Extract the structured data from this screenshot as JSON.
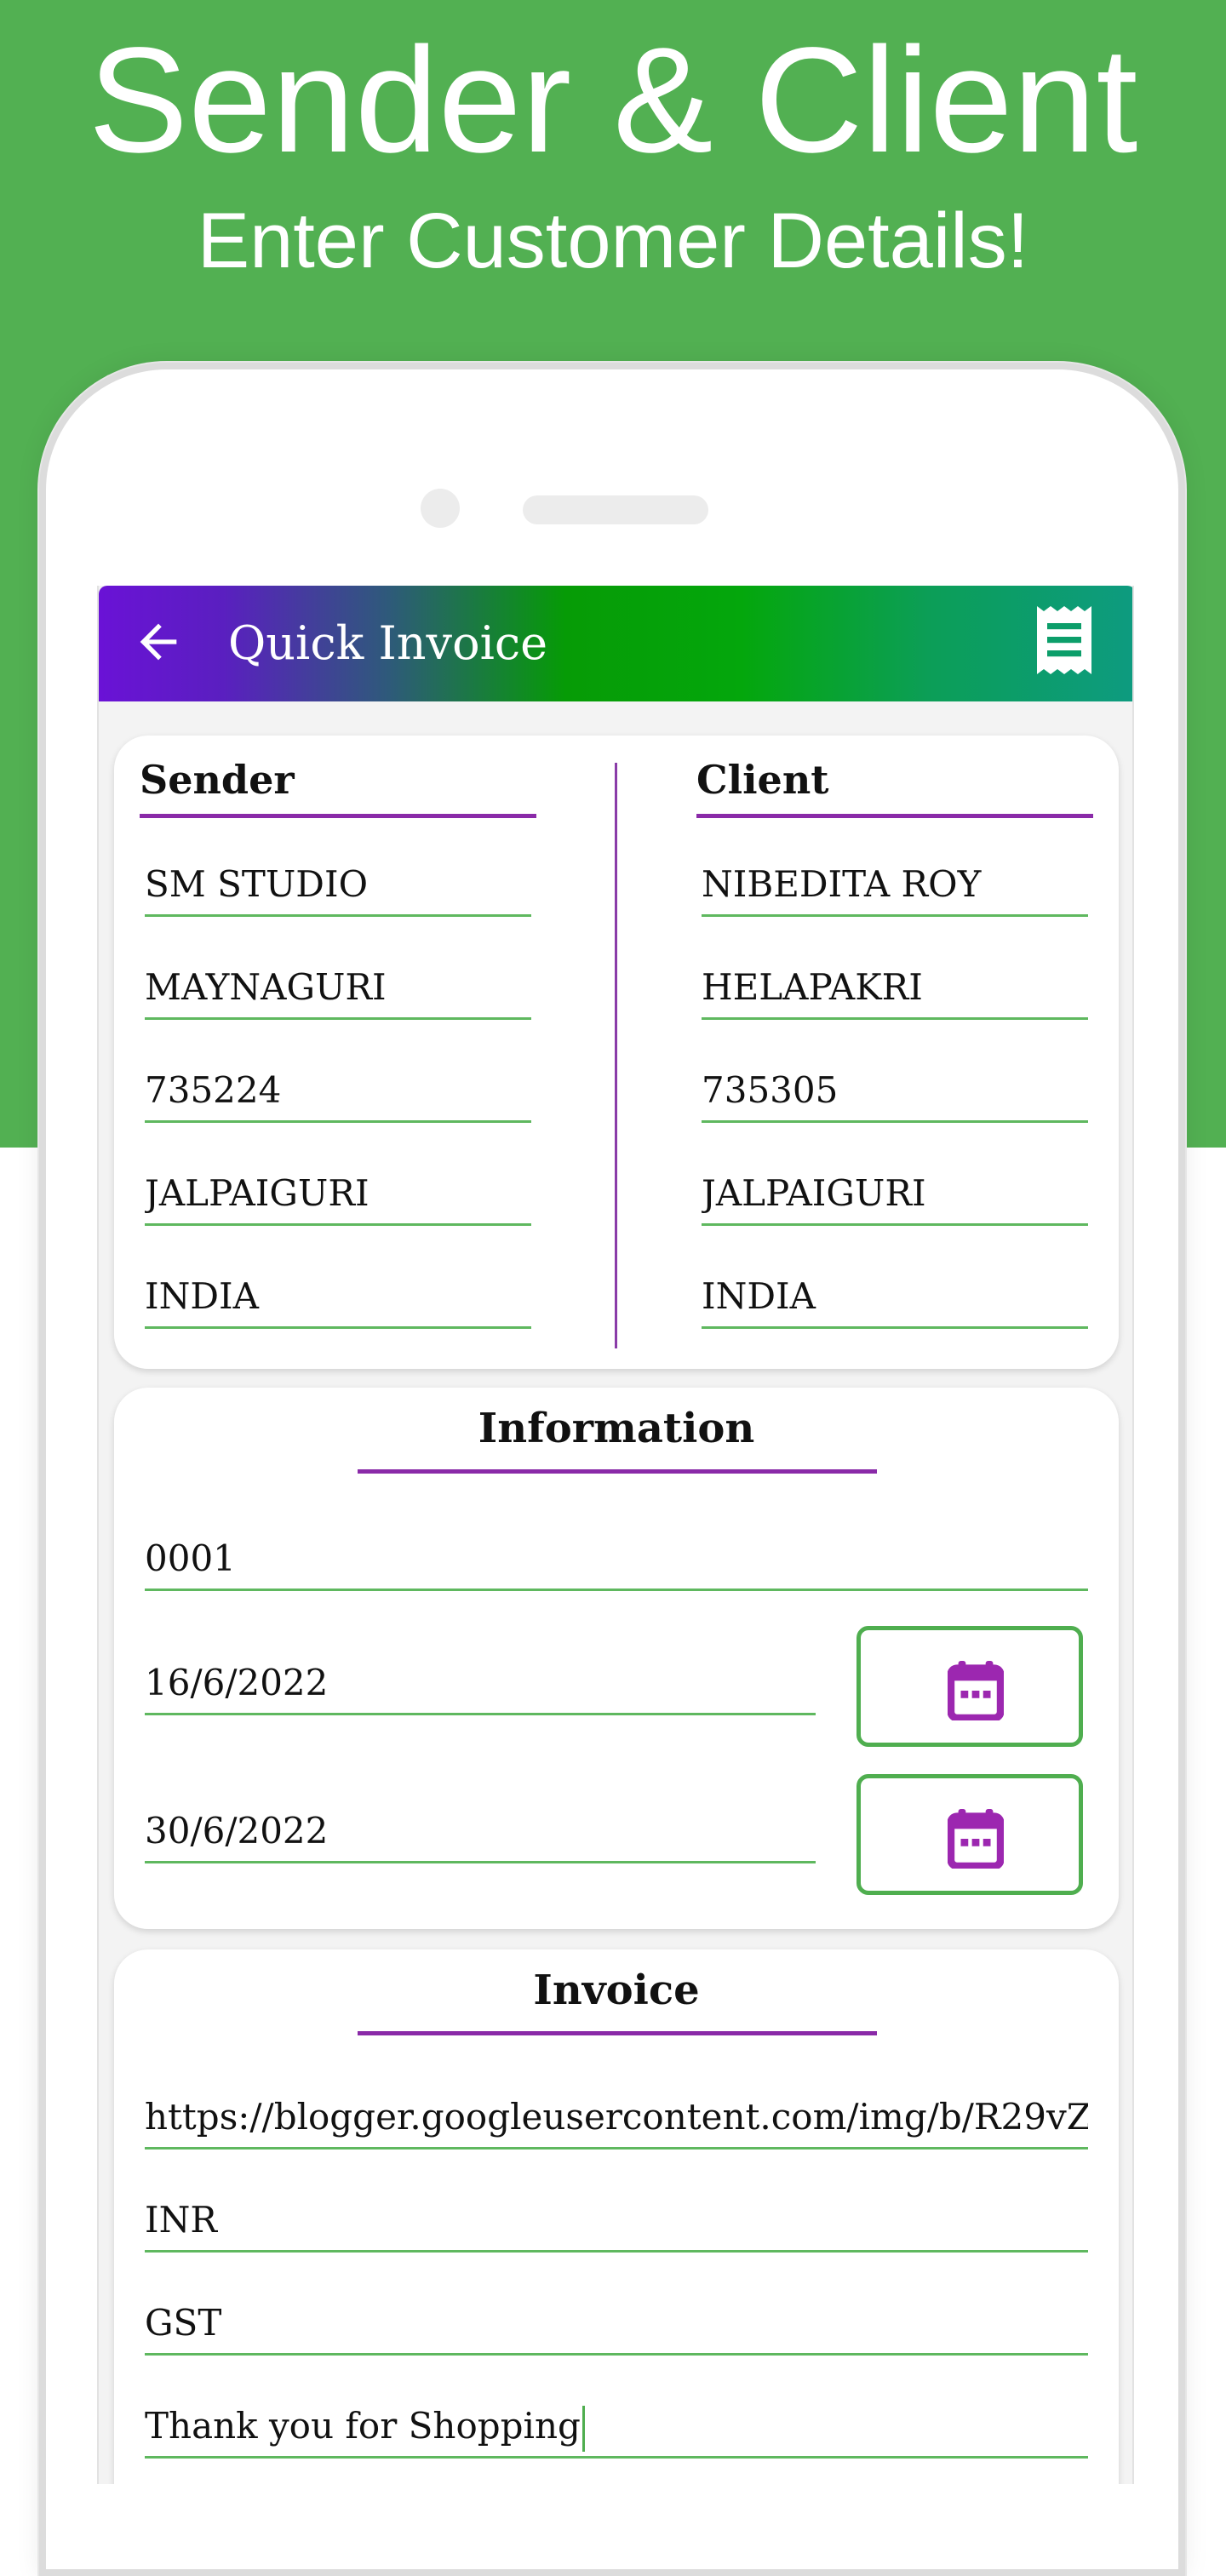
{
  "promo": {
    "title": "Sender & Client",
    "subtitle": "Enter Customer Details!"
  },
  "appbar": {
    "title": "Quick Invoice",
    "back_icon": "arrow-left-icon",
    "action_icon": "receipt-icon"
  },
  "sender": {
    "heading": "Sender",
    "fields": [
      "SM STUDIO",
      "MAYNAGURI",
      "735224",
      "JALPAIGURI",
      "INDIA"
    ]
  },
  "client": {
    "heading": "Client",
    "fields": [
      "NIBEDITA ROY",
      "HELAPAKRI",
      "735305",
      "JALPAIGURI",
      "INDIA"
    ]
  },
  "information": {
    "heading": "Information",
    "invoice_number": "0001",
    "date_1": "16/6/2022",
    "date_2": "30/6/2022",
    "calendar_icon": "calendar-icon"
  },
  "invoice": {
    "heading": "Invoice",
    "logo_url": "https://blogger.googleusercontent.com/img/b/R29vZ",
    "currency": "INR",
    "tax": "GST",
    "note": "Thank you for Shopping"
  },
  "colors": {
    "promo_green": "#52b052",
    "accent_purple": "#8a2aa8",
    "field_green": "#5fb85f",
    "calendar_purple": "#9c27b0"
  }
}
